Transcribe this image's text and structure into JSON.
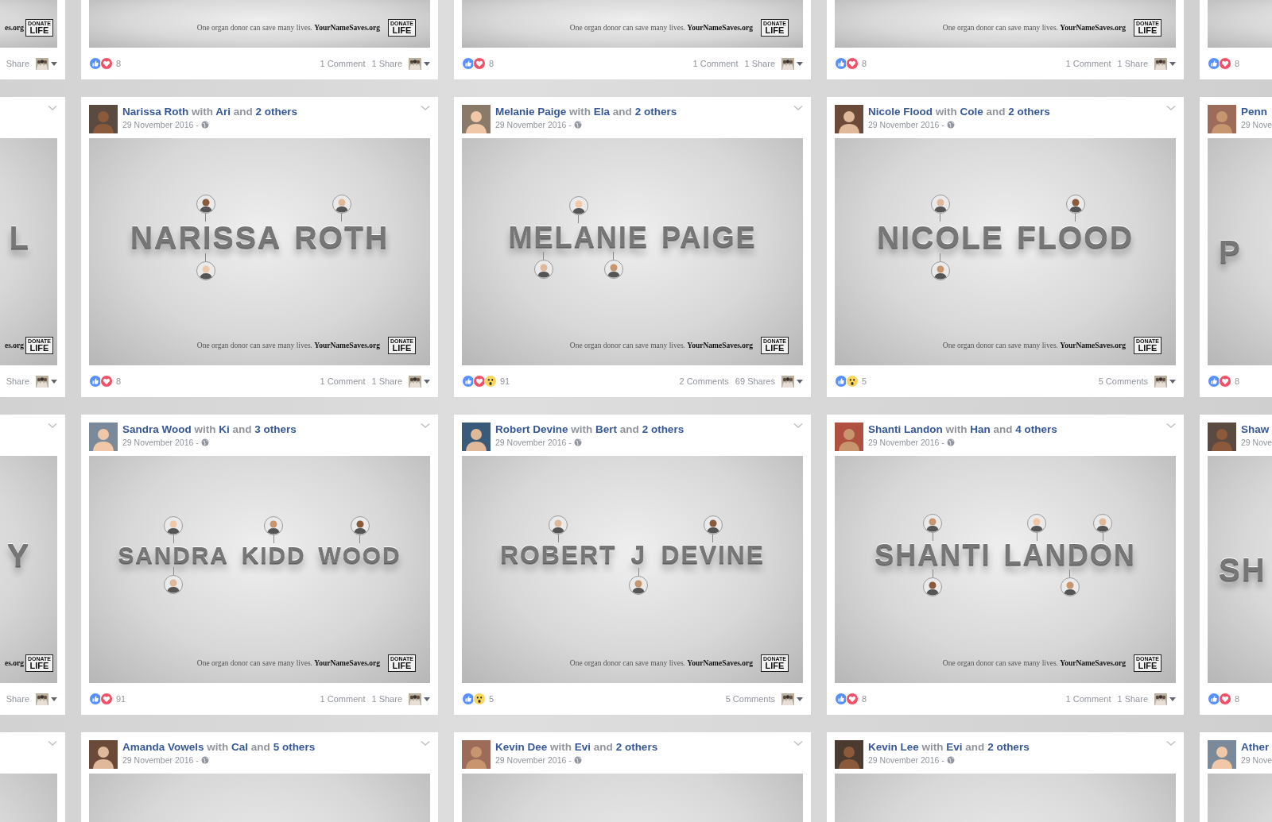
{
  "rows": [
    {
      "cards": [
        {
          "kind": "edge_left",
          "image": {
            "tagline": "**es.org**",
            "logo": {
              "top": "DONATE",
              "bottom": "LIFE"
            }
          },
          "footer": {
            "shares": "Share",
            "audience": true
          }
        },
        {
          "kind": "full",
          "image": {
            "tagline": "One organ donor can save many lives. **YourNameSaves.org**",
            "logo": {
              "top": "DONATE",
              "bottom": "LIFE"
            }
          },
          "footer": {
            "reactions": [
              {
                "kind": "like"
              },
              {
                "kind": "love"
              }
            ],
            "count": "8",
            "comments": "1 Comment",
            "shares": "1 Share",
            "audience": true
          }
        },
        {
          "kind": "full",
          "image": {
            "tagline": "One organ donor can save many lives. **YourNameSaves.org**",
            "logo": {
              "top": "DONATE",
              "bottom": "LIFE"
            }
          },
          "footer": {
            "reactions": [
              {
                "kind": "like"
              },
              {
                "kind": "love"
              }
            ],
            "count": "8",
            "comments": "1 Comment",
            "shares": "1 Share",
            "audience": true
          }
        },
        {
          "kind": "full",
          "image": {
            "tagline": "One organ donor can save many lives. **YourNameSaves.org**",
            "logo": {
              "top": "DONATE",
              "bottom": "LIFE"
            }
          },
          "footer": {
            "reactions": [
              {
                "kind": "like"
              },
              {
                "kind": "love"
              }
            ],
            "count": "8",
            "comments": "1 Comment",
            "shares": "1 Share",
            "audience": true
          }
        },
        {
          "kind": "edge_right",
          "footer": {
            "reactions": [
              {
                "kind": "like"
              },
              {
                "kind": "love"
              }
            ],
            "count": "8"
          }
        }
      ]
    },
    {
      "cards": [
        {
          "kind": "edge_left",
          "menu_button": true,
          "image": {
            "words": [
              {
                "text": "L"
              }
            ],
            "tagline": "**es.org**",
            "logo": {
              "top": "DONATE",
              "bottom": "LIFE"
            }
          },
          "footer": {
            "shares": "Share",
            "audience": true
          }
        },
        {
          "kind": "full",
          "menu_button": true,
          "header": {
            "author": "Narissa Roth",
            "with": "with",
            "tagged": "Ari",
            "and": "and",
            "others": "2 others",
            "date": "29 November 2016",
            "separator": "-"
          },
          "image": {
            "words": [
              {
                "text": "NARISSA",
                "faces": [
                  {
                    "kind": "above"
                  },
                  {
                    "kind": "below"
                  }
                ]
              },
              {
                "text": "ROTH",
                "faces": [
                  {
                    "kind": "above"
                  }
                ]
              }
            ],
            "tagline": "One organ donor can save many lives. **YourNameSaves.org**",
            "logo": {
              "top": "DONATE",
              "bottom": "LIFE"
            }
          },
          "footer": {
            "reactions": [
              {
                "kind": "like"
              },
              {
                "kind": "love"
              }
            ],
            "count": "8",
            "comments": "1 Comment",
            "shares": "1 Share",
            "audience": true
          }
        },
        {
          "kind": "full",
          "menu_button": true,
          "header": {
            "author": "Melanie Paige",
            "with": "with",
            "tagged": "Ela",
            "and": "and",
            "others": "2 others",
            "date": "29 November 2016",
            "separator": "-"
          },
          "image": {
            "words": [
              {
                "text": "MELANIE",
                "faces": [
                  {
                    "kind": "above"
                  },
                  {
                    "kind": "below"
                  },
                  {
                    "kind": "below"
                  }
                ]
              },
              {
                "text": "PAIGE"
              }
            ],
            "tagline": "One organ donor can save many lives. **YourNameSaves.org**",
            "logo": {
              "top": "DONATE",
              "bottom": "LIFE"
            }
          },
          "footer": {
            "reactions": [
              {
                "kind": "like"
              },
              {
                "kind": "love"
              },
              {
                "kind": "wow"
              }
            ],
            "count": "91",
            "comments": "2 Comments",
            "shares": "69 Shares",
            "audience": true
          }
        },
        {
          "kind": "full",
          "menu_button": true,
          "header": {
            "author": "Nicole Flood",
            "with": "with",
            "tagged": "Cole",
            "and": "and",
            "others": "2 others",
            "date": "29 November 2016",
            "separator": "-"
          },
          "image": {
            "words": [
              {
                "text": "NICOLE",
                "faces": [
                  {
                    "kind": "above"
                  },
                  {
                    "kind": "below"
                  }
                ]
              },
              {
                "text": "FLOOD",
                "faces": [
                  {
                    "kind": "above"
                  }
                ]
              }
            ],
            "tagline": "One organ donor can save many lives. **YourNameSaves.org**",
            "logo": {
              "top": "DONATE",
              "bottom": "LIFE"
            }
          },
          "footer": {
            "reactions": [
              {
                "kind": "like"
              },
              {
                "kind": "wow"
              }
            ],
            "count": "5",
            "comments": "5 Comments",
            "audience": true
          }
        },
        {
          "kind": "edge_right",
          "header": {
            "author": "Penn",
            "date": "29 Nove"
          },
          "image": {
            "words": [
              {
                "text": "P"
              }
            ]
          },
          "footer": {
            "reactions": [
              {
                "kind": "like"
              },
              {
                "kind": "love"
              }
            ],
            "count": "8"
          }
        }
      ]
    },
    {
      "cards": [
        {
          "kind": "edge_left",
          "menu_button": true,
          "image": {
            "words": [
              {
                "text": "Y"
              }
            ],
            "tagline": "**es.org**",
            "logo": {
              "top": "DONATE",
              "bottom": "LIFE"
            }
          },
          "footer": {
            "shares": "Share",
            "audience": true
          }
        },
        {
          "kind": "full",
          "menu_button": true,
          "header": {
            "author": "Sandra Wood",
            "with": "with",
            "tagged": "Ki",
            "and": "and",
            "others": "3 others",
            "date": "29 November 2016",
            "separator": "-"
          },
          "image": {
            "words": [
              {
                "text": "SANDRA",
                "faces": [
                  {
                    "kind": "above"
                  },
                  {
                    "kind": "below"
                  }
                ]
              },
              {
                "text": "KIDD",
                "faces": [
                  {
                    "kind": "above"
                  }
                ]
              },
              {
                "text": "WOOD",
                "faces": [
                  {
                    "kind": "above"
                  }
                ]
              }
            ],
            "tagline": "One organ donor can save many lives. **YourNameSaves.org**",
            "logo": {
              "top": "DONATE",
              "bottom": "LIFE"
            }
          },
          "footer": {
            "reactions": [
              {
                "kind": "like"
              },
              {
                "kind": "love"
              }
            ],
            "count": "91",
            "comments": "1 Comment",
            "shares": "1 Share",
            "audience": true
          }
        },
        {
          "kind": "full",
          "menu_button": true,
          "header": {
            "author": "Robert Devine",
            "with": "with",
            "tagged": "Bert",
            "and": "and",
            "others": "2 others",
            "date": "29 November 2016",
            "separator": "-"
          },
          "image": {
            "words": [
              {
                "text": "ROBERT",
                "faces": [
                  {
                    "kind": "above"
                  }
                ]
              },
              {
                "text": "J",
                "faces": [
                  {
                    "kind": "below"
                  }
                ]
              },
              {
                "text": "DEVINE",
                "faces": [
                  {
                    "kind": "above"
                  }
                ]
              }
            ],
            "tagline": "One organ donor can save many lives. **YourNameSaves.org**",
            "logo": {
              "top": "DONATE",
              "bottom": "LIFE"
            }
          },
          "footer": {
            "reactions": [
              {
                "kind": "like"
              },
              {
                "kind": "wow"
              }
            ],
            "count": "5",
            "comments": "5 Comments",
            "audience": true
          }
        },
        {
          "kind": "full",
          "menu_button": true,
          "header": {
            "author": "Shanti Landon",
            "with": "with",
            "tagged": "Han",
            "and": "and",
            "others": "4 others",
            "date": "29 November 2016",
            "separator": "-"
          },
          "image": {
            "words": [
              {
                "text": "SHANTI",
                "faces": [
                  {
                    "kind": "above"
                  },
                  {
                    "kind": "below"
                  }
                ]
              },
              {
                "text": "LANDON",
                "faces": [
                  {
                    "kind": "above"
                  },
                  {
                    "kind": "above"
                  },
                  {
                    "kind": "below"
                  }
                ]
              }
            ],
            "tagline": "One organ donor can save many lives. **YourNameSaves.org**",
            "logo": {
              "top": "DONATE",
              "bottom": "LIFE"
            }
          },
          "footer": {
            "reactions": [
              {
                "kind": "like"
              },
              {
                "kind": "love"
              }
            ],
            "count": "8",
            "comments": "1 Comment",
            "shares": "1 Share",
            "audience": true
          }
        },
        {
          "kind": "edge_right",
          "header": {
            "author": "Shaw",
            "date": "29 Nove"
          },
          "image": {
            "words": [
              {
                "text": "SH"
              }
            ]
          },
          "footer": {
            "reactions": [
              {
                "kind": "like"
              },
              {
                "kind": "love"
              }
            ],
            "count": "8"
          }
        }
      ]
    },
    {
      "cards": [
        {
          "kind": "edge_left",
          "menu_button": true
        },
        {
          "kind": "full",
          "menu_button": true,
          "header": {
            "author": "Amanda Vowels",
            "with": "with",
            "tagged": "Cal",
            "and": "and",
            "others": "5 others",
            "date": "29 November 2016",
            "separator": "-"
          }
        },
        {
          "kind": "full",
          "menu_button": true,
          "header": {
            "author": "Kevin Dee",
            "with": "with",
            "tagged": "Evi",
            "and": "and",
            "others": "2 others",
            "date": "29 November 2016",
            "separator": "-"
          }
        },
        {
          "kind": "full",
          "menu_button": true,
          "header": {
            "author": "Kevin Lee",
            "with": "with",
            "tagged": "Evi",
            "and": "and",
            "others": "2 others",
            "date": "29 November 2016",
            "separator": "-"
          }
        },
        {
          "kind": "edge_right",
          "header": {
            "author": "Ather",
            "date": "29 Nove"
          }
        }
      ]
    }
  ]
}
